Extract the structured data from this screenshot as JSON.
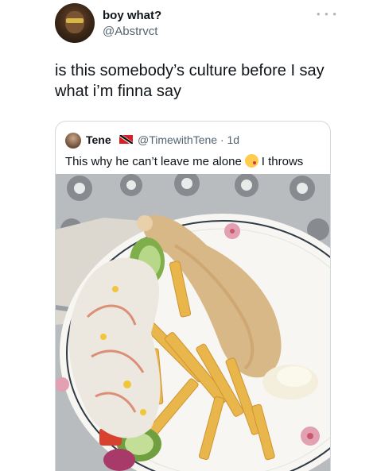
{
  "tweet": {
    "display_name": "boy what?",
    "handle": "@Abstrvct",
    "text": "is this somebody’s culture before I say what i’m finna say",
    "more_icon": "more-options-icon"
  },
  "quote": {
    "name": "Tene",
    "flag_icon": "trinidad-and-tobago-flag-icon",
    "handle_time": "@TimewithTene · 1d",
    "text_before": "This why he can’t leave me alone",
    "emoji_icon": "face-blowing-kiss-emoji-icon",
    "text_after": "I throws",
    "image_description_icon": "food-photo"
  },
  "colors": {
    "text": "#0f1419",
    "secondary": "#536471",
    "border": "#cfd9de"
  }
}
